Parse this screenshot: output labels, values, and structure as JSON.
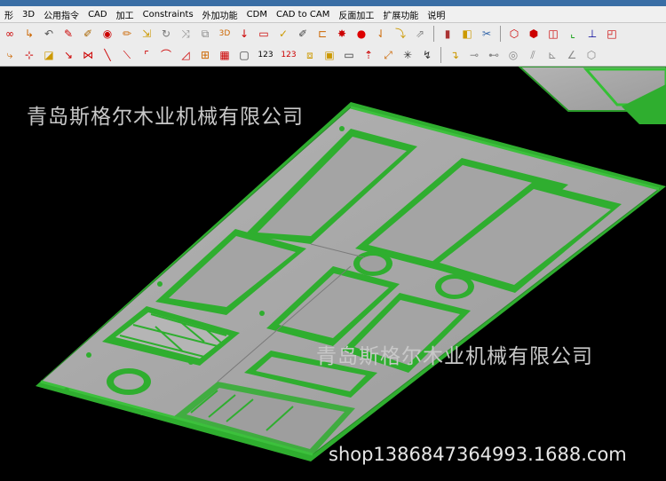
{
  "menu": [
    "形",
    "3D",
    "公用指令",
    "CAD",
    "加工",
    "Constraints",
    "外加功能",
    "CDM",
    "CAD to CAM",
    "反面加工",
    "扩展功能",
    "说明"
  ],
  "toolbar1_icons": [
    "link-icon",
    "arrow-icon",
    "undo-icon",
    "edit-icon",
    "pen-icon",
    "record-icon",
    "pencil-icon",
    "move-icon",
    "rotate-icon",
    "transform-icon",
    "copy-icon",
    "3d-icon",
    "delete-icon",
    "rectangle-icon",
    "brush-icon",
    "erase-icon",
    "circle-icon",
    "trim-icon",
    "fill-icon",
    "dot-icon",
    "merge-icon",
    "shape-icon",
    "book-icon",
    "cube-icon",
    "clip-icon",
    "view-iso-icon",
    "view-front-icon",
    "view-top-icon",
    "axis-icon",
    "axis2-icon",
    "cube-view-icon"
  ],
  "toolbar2_icons": [
    "snap-icon",
    "point-icon",
    "square-icon",
    "angle-icon",
    "wave-icon",
    "line-icon",
    "polyline-icon",
    "arc-icon",
    "curve-icon",
    "triangle-icon",
    "grid-icon",
    "table-icon",
    "box-icon",
    "123-icon",
    "sort-icon",
    "layers-icon",
    "frame-icon",
    "text-icon",
    "move-up-icon",
    "mirror-icon",
    "explode-icon",
    "corner-icon",
    "dimension-icon",
    "dash-icon",
    "circle-dim-icon",
    "parallel-icon",
    "perp-icon",
    "hex-icon"
  ],
  "numbering_text": [
    "123",
    "123"
  ],
  "watermark_top": "青岛斯格尔木业机械有限公司",
  "watermark_middle": "青岛斯格尔木业机械有限公司",
  "watermark_shop": "shop1386847364993.1688.com",
  "colors": {
    "wood_green": "#2fae2f",
    "panel_gray": "#a8a8a8",
    "edge_dark": "#1d6e1d"
  }
}
